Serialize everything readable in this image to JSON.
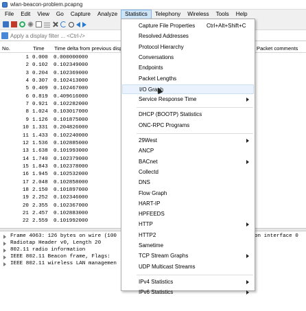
{
  "window": {
    "title": "wlan-beacon-problem.pcapng"
  },
  "menubar": [
    "File",
    "Edit",
    "View",
    "Go",
    "Capture",
    "Analyze",
    "Statistics",
    "Telephony",
    "Wireless",
    "Tools",
    "Help"
  ],
  "active_menu": "Statistics",
  "filter": {
    "placeholder": "Apply a display filter ... <Ctrl-/>"
  },
  "columns": {
    "no": "No.",
    "time": "Time",
    "delta": "Time delta from previous disp",
    "comments": "Packet comments"
  },
  "packets": [
    {
      "no": "1",
      "time": "0.000",
      "delta": "0.000000000"
    },
    {
      "no": "2",
      "time": "0.102",
      "delta": "0.102349000"
    },
    {
      "no": "3",
      "time": "0.204",
      "delta": "0.102369000"
    },
    {
      "no": "4",
      "time": "0.307",
      "delta": "0.102413000"
    },
    {
      "no": "5",
      "time": "0.409",
      "delta": "0.102467000"
    },
    {
      "no": "6",
      "time": "0.819",
      "delta": "0.409616000"
    },
    {
      "no": "7",
      "time": "0.921",
      "delta": "0.102282000"
    },
    {
      "no": "8",
      "time": "1.024",
      "delta": "0.103017000"
    },
    {
      "no": "9",
      "time": "1.126",
      "delta": "0.101875000"
    },
    {
      "no": "10",
      "time": "1.331",
      "delta": "0.204826000"
    },
    {
      "no": "11",
      "time": "1.433",
      "delta": "0.102240000"
    },
    {
      "no": "12",
      "time": "1.536",
      "delta": "0.102885000"
    },
    {
      "no": "13",
      "time": "1.638",
      "delta": "0.101993000"
    },
    {
      "no": "14",
      "time": "1.740",
      "delta": "0.102379000"
    },
    {
      "no": "15",
      "time": "1.843",
      "delta": "0.102378000"
    },
    {
      "no": "16",
      "time": "1.945",
      "delta": "0.102532000"
    },
    {
      "no": "17",
      "time": "2.048",
      "delta": "0.102858000"
    },
    {
      "no": "18",
      "time": "2.150",
      "delta": "0.101897000"
    },
    {
      "no": "19",
      "time": "2.252",
      "delta": "0.102346000"
    },
    {
      "no": "20",
      "time": "2.355",
      "delta": "0.102367000"
    },
    {
      "no": "21",
      "time": "2.457",
      "delta": "0.102883000"
    },
    {
      "no": "22",
      "time": "2.559",
      "delta": "0.101992000"
    }
  ],
  "details": [
    {
      "text": "Frame 4063: 126 bytes on wire (100",
      "tail": "on interface 0"
    },
    {
      "text": "Radiotap Header v0, Length 20",
      "tail": ""
    },
    {
      "text": "802.11 radio information",
      "tail": ""
    },
    {
      "text": "IEEE 802.11 Beacon frame, Flags:",
      "tail": ""
    },
    {
      "text": "IEEE 802.11 wireless LAN managemen",
      "tail": ""
    }
  ],
  "statistics_menu": [
    {
      "label": "Capture File Properties",
      "shortcut": "Ctrl+Alt+Shift+C",
      "submenu": false
    },
    {
      "label": "Resolved Addresses",
      "submenu": false
    },
    {
      "label": "Protocol Hierarchy",
      "submenu": false
    },
    {
      "label": "Conversations",
      "submenu": false
    },
    {
      "label": "Endpoints",
      "submenu": false
    },
    {
      "label": "Packet Lengths",
      "submenu": false
    },
    {
      "label": "I/O Graph",
      "submenu": false,
      "hover": true
    },
    {
      "label": "Service Response Time",
      "submenu": true
    },
    {
      "label": "DHCP (BOOTP) Statistics",
      "submenu": false
    },
    {
      "label": "ONC-RPC Programs",
      "submenu": false
    },
    {
      "label": "29West",
      "submenu": true
    },
    {
      "label": "ANCP",
      "submenu": false
    },
    {
      "label": "BACnet",
      "submenu": true
    },
    {
      "label": "Collectd",
      "submenu": false
    },
    {
      "label": "DNS",
      "submenu": false
    },
    {
      "label": "Flow Graph",
      "submenu": false
    },
    {
      "label": "HART-IP",
      "submenu": false
    },
    {
      "label": "HPFEEDS",
      "submenu": false
    },
    {
      "label": "HTTP",
      "submenu": true
    },
    {
      "label": "HTTP2",
      "submenu": false
    },
    {
      "label": "Sametime",
      "submenu": false
    },
    {
      "label": "TCP Stream Graphs",
      "submenu": true
    },
    {
      "label": "UDP Multicast Streams",
      "submenu": false
    },
    {
      "label": "IPv4 Statistics",
      "submenu": true
    },
    {
      "label": "IPv6 Statistics",
      "submenu": true
    }
  ]
}
